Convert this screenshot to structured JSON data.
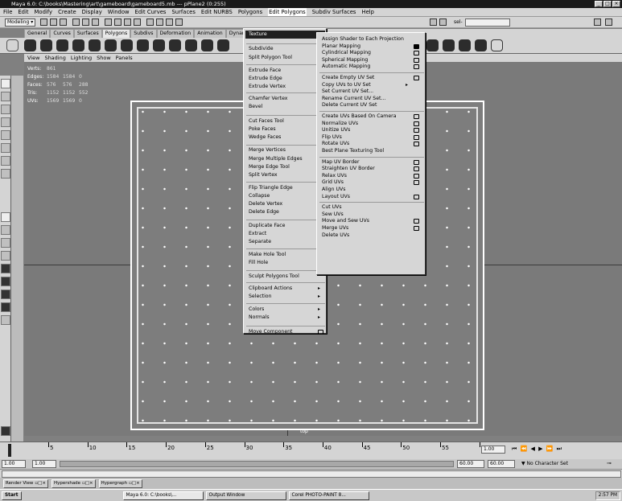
{
  "window": {
    "title": "Maya 6.0: C:\\books\\Mastering\\art\\gameboard\\gameboard5.mb  ---  pPlane2 (0:255)"
  },
  "menubar": [
    "File",
    "Edit",
    "Modify",
    "Create",
    "Display",
    "Window",
    "Edit Curves",
    "Surfaces",
    "Edit NURBS",
    "Polygons",
    "Edit Polygons",
    "Subdiv Surfaces",
    "Help"
  ],
  "status_line": {
    "mode": "Modeling",
    "sel_label": "sel-"
  },
  "shelf_tabs": [
    "General",
    "Curves",
    "Surfaces",
    "Polygons",
    "Subdivs",
    "Deformation",
    "Animation",
    "Dynamics",
    "R"
  ],
  "active_shelf_tab": "Polygons",
  "viewport_menu": [
    "View",
    "Shading",
    "Lighting",
    "Show",
    "Panels"
  ],
  "hud": {
    "rows": [
      {
        "label": "Verts:",
        "a": "861",
        "b": "",
        "c": ""
      },
      {
        "label": "Edges:",
        "a": "1584",
        "b": "1584",
        "c": "0"
      },
      {
        "label": "Faces:",
        "a": "576",
        "b": "576",
        "c": "288"
      },
      {
        "label": "Tris:",
        "a": "1152",
        "b": "1152",
        "c": "552"
      },
      {
        "label": "UVs:",
        "a": "1569",
        "b": "1569",
        "c": "0"
      }
    ]
  },
  "camera_label": "top",
  "edit_polygons_menu": [
    "Texture",
    "Subdivide",
    "Split Polygon Tool",
    "Extrude Face",
    "Extrude Edge",
    "Extrude Vertex",
    "Chamfer Vertex",
    "Bevel",
    "Cut Faces Tool",
    "Poke Faces",
    "Wedge Faces",
    "Merge Vertices",
    "Merge Multiple Edges",
    "Merge Edge Tool",
    "Split Vertex",
    "Flip Triangle Edge",
    "Collapse",
    "Delete Vertex",
    "Delete Edge",
    "Duplicate Face",
    "Extract",
    "Separate",
    "Make Hole Tool",
    "Fill Hole",
    "Sculpt Polygons Tool",
    "Clipboard Actions",
    "Selection",
    "Colors",
    "Normals",
    "Move Component"
  ],
  "texture_submenu": [
    "Assign Shader to Each Projection",
    "Planar Mapping",
    "Cylindrical Mapping",
    "Spherical Mapping",
    "Automatic Mapping",
    "Create Empty UV Set",
    "Copy UVs to UV Set",
    "Set Current UV Set...",
    "Rename Current UV Set...",
    "Delete Current UV Set",
    "Create UVs Based On Camera",
    "Normalize UVs",
    "Unitize UVs",
    "Flip UVs",
    "Rotate UVs",
    "Best Plane Texturing Tool",
    "Map UV Border",
    "Straighten UV Border",
    "Relax UVs",
    "Grid UVs",
    "Align UVs",
    "Layout UVs",
    "Cut UVs",
    "Sew UVs",
    "Move and Sew UVs",
    "Merge UVs",
    "Delete UVs"
  ],
  "timeline": {
    "ticks": [
      "5",
      "10",
      "15",
      "20",
      "25",
      "30",
      "35",
      "40",
      "45",
      "50",
      "55",
      "60"
    ],
    "current_frame": "1.00"
  },
  "range": {
    "start": "1.00",
    "inner_start": "1.00",
    "inner_end": "60.00",
    "end": "60.00",
    "character_set": "No Character Set"
  },
  "minimized_windows": [
    "Render View",
    "Hypershade",
    "Hypergraph"
  ],
  "taskbar": {
    "start": "Start",
    "buttons": [
      "Maya 6.0: C:\\books\\...",
      "Output Window",
      "Corel PHOTO-PAINT 8..."
    ],
    "clock": "2:57 PM"
  }
}
